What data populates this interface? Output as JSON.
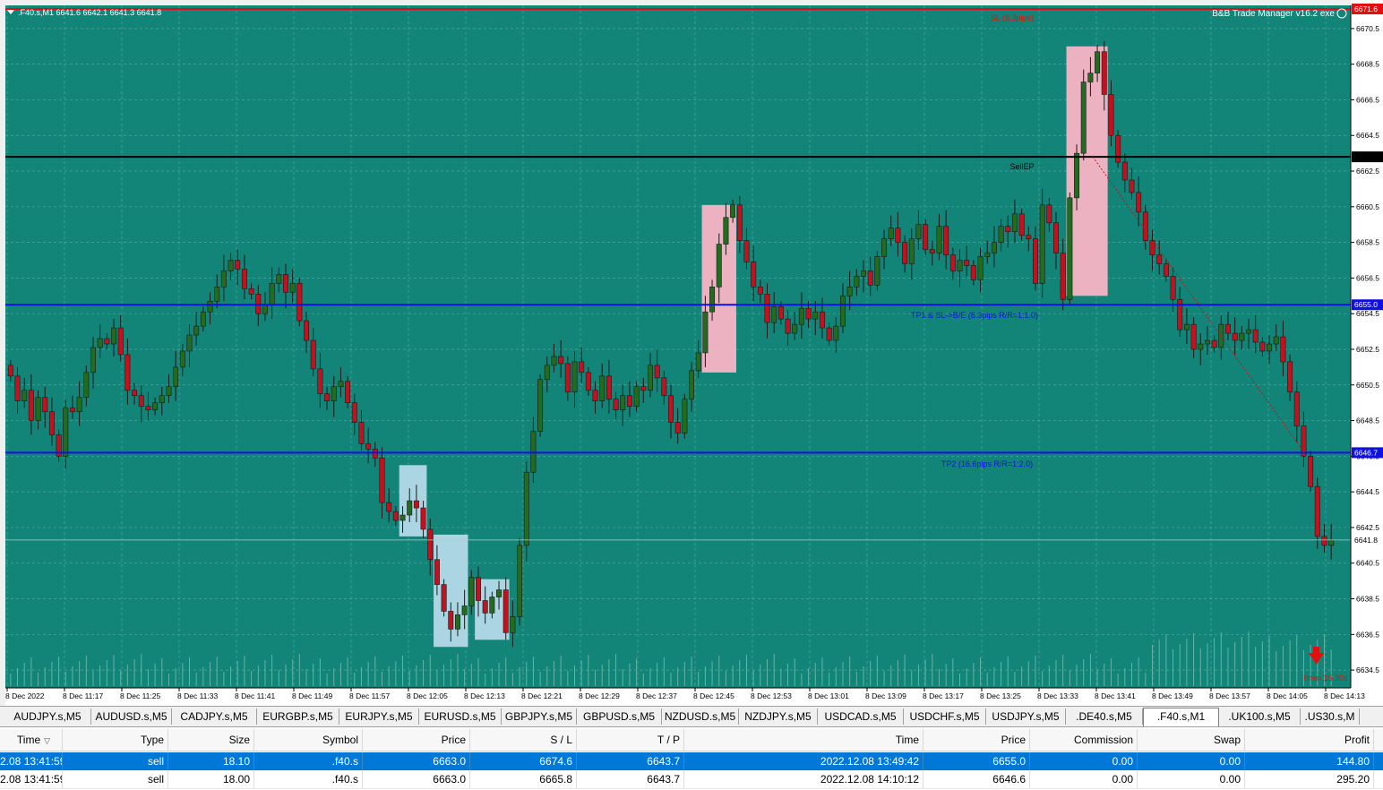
{
  "chart": {
    "header_text": ".F40.s,M1  6641.6 6642.1 6641.3 6641.8",
    "ea_label": "B&B Trade Manager v16.2 exe",
    "sl_label": "SL (8.3pips)",
    "sell_ep_label": "SellEP",
    "tp1_label": "TP1 & SL->B/E (8.3pips R/R=1:1.0)",
    "tp2_label": "TP2 (16.6pips R/R=1:2.0)",
    "countdown_label": "0min 15.20s",
    "price_tags": {
      "sl": "6671.6",
      "sell_ep": "6663.3",
      "tp1": "6655.0",
      "tp2": "6646.7",
      "bid": "6641.8"
    },
    "y_axis_ticks": [
      "6670.5",
      "6668.5",
      "6666.5",
      "6664.5",
      "6662.5",
      "6660.5",
      "6658.5",
      "6656.5",
      "6654.5",
      "6652.5",
      "6650.5",
      "6648.5",
      "6646.5",
      "6644.5",
      "6642.5",
      "6640.5",
      "6638.5",
      "6636.5",
      "6634.5"
    ],
    "x_axis_ticks": [
      "8 Dec 2022",
      "8 Dec 11:17",
      "8 Dec 11:25",
      "8 Dec 11:33",
      "8 Dec 11:41",
      "8 Dec 11:49",
      "8 Dec 11:57",
      "8 Dec 12:05",
      "8 Dec 12:13",
      "8 Dec 12:21",
      "8 Dec 12:29",
      "8 Dec 12:37",
      "8 Dec 12:45",
      "8 Dec 12:53",
      "8 Dec 13:01",
      "8 Dec 13:09",
      "8 Dec 13:17",
      "8 Dec 13:25",
      "8 Dec 13:33",
      "8 Dec 13:41",
      "8 Dec 13:49",
      "8 Dec 13:57",
      "8 Dec 14:05",
      "8 Dec 14:13"
    ],
    "colors": {
      "background": "#138478",
      "grid": "#4fa89d",
      "bull": "#236b1f",
      "bear": "#c1121f",
      "sl_line": "#e01010",
      "entry_line": "#000000",
      "tp_line": "#1010e0",
      "pink_zone": "#ffb6c8",
      "blue_zone": "#b8dcec"
    },
    "chart_data": {
      "type": "candlestick",
      "symbol": ".F40.s",
      "timeframe": "M1",
      "ylim": [
        6633.5,
        6671.8
      ],
      "levels": {
        "sl": 6671.6,
        "sell_entry": 6663.3,
        "tp1": 6655.0,
        "tp2": 6646.7,
        "bid": 6641.8
      },
      "close_prices": [
        6651.0,
        6649.6,
        6650.2,
        6648.5,
        6649.8,
        6649.0,
        6647.7,
        6646.5,
        6649.2,
        6649.0,
        6649.8,
        6651.2,
        6652.6,
        6653.1,
        6652.8,
        6653.7,
        6652.2,
        6650.2,
        6649.9,
        6649.3,
        6649.1,
        6649.5,
        6649.9,
        6650.4,
        6651.5,
        6652.4,
        6653.3,
        6653.8,
        6654.6,
        6655.2,
        6656.0,
        6656.9,
        6657.5,
        6657.0,
        6655.9,
        6655.6,
        6654.5,
        6655.0,
        6656.2,
        6656.7,
        6655.7,
        6656.2,
        6654.1,
        6653.0,
        6651.4,
        6650.0,
        6649.6,
        6650.4,
        6650.7,
        6649.5,
        6648.4,
        6647.2,
        6646.9,
        6646.4,
        6643.9,
        6643.4,
        6642.9,
        6643.2,
        6644.0,
        6643.6,
        6642.4,
        6640.7,
        6639.3,
        6637.8,
        6636.8,
        6637.6,
        6638.1,
        6639.7,
        6638.4,
        6637.7,
        6638.6,
        6639.0,
        6636.6,
        6637.5,
        6641.5,
        6645.6,
        6647.9,
        6650.8,
        6651.6,
        6652.1,
        6651.7,
        6650.1,
        6651.8,
        6651.2,
        6650.2,
        6649.6,
        6651.0,
        6649.7,
        6649.1,
        6649.9,
        6649.3,
        6650.4,
        6650.2,
        6651.6,
        6650.9,
        6649.9,
        6648.4,
        6647.8,
        6649.7,
        6651.3,
        6652.3,
        6654.6,
        6656.0,
        6658.4,
        6659.9,
        6660.6,
        6658.6,
        6657.4,
        6656.0,
        6655.6,
        6654.0,
        6654.9,
        6654.2,
        6653.4,
        6653.9,
        6654.8,
        6654.2,
        6654.6,
        6653.7,
        6653.0,
        6653.8,
        6655.5,
        6656.0,
        6656.6,
        6656.9,
        6656.1,
        6657.7,
        6658.7,
        6659.3,
        6658.5,
        6657.3,
        6658.7,
        6659.5,
        6658.1,
        6657.9,
        6659.4,
        6657.8,
        6656.9,
        6657.5,
        6657.2,
        6656.4,
        6657.7,
        6657.9,
        6658.5,
        6659.4,
        6659.1,
        6660.1,
        6658.9,
        6658.7,
        6656.2,
        6660.6,
        6659.6,
        6657.9,
        6655.3,
        6661.0,
        6663.5,
        6667.5,
        6668.0,
        6669.2,
        6666.8,
        6664.5,
        6663.0,
        6662.0,
        6661.3,
        6660.2,
        6658.6,
        6657.8,
        6657.3,
        6656.6,
        6655.3,
        6653.6,
        6653.9,
        6652.5,
        6652.8,
        6653.0,
        6652.6,
        6653.9,
        6653.4,
        6653.0,
        6653.4,
        6653.6,
        6652.9,
        6652.4,
        6652.8,
        6653.2,
        6651.8,
        6650.1,
        6648.2,
        6646.5,
        6644.8,
        6642.0,
        6641.5,
        6641.8
      ],
      "y_axis_tick_values": [
        6670.5,
        6668.5,
        6666.5,
        6664.5,
        6662.5,
        6660.5,
        6658.5,
        6656.5,
        6654.5,
        6652.5,
        6650.5,
        6648.5,
        6646.5,
        6644.5,
        6642.5,
        6640.5,
        6638.5,
        6636.5,
        6634.5
      ]
    }
  },
  "tabs": {
    "items": [
      "AUDJPY.s,M5",
      "AUDUSD.s,M5",
      "CADJPY.s,M5",
      "EURGBP.s,M5",
      "EURJPY.s,M5",
      "EURUSD.s,M5",
      "GBPJPY.s,M5",
      "GBPUSD.s,M5",
      "NZDUSD.s,M5",
      "NZDJPY.s,M5",
      "USDCAD.s,M5",
      "USDCHF.s,M5",
      "USDJPY.s,M5",
      ".DE40.s,M5",
      ".F40.s,M1",
      ".UK100.s,M5",
      ".US30.s,M"
    ],
    "active_index": 14
  },
  "orders": {
    "columns": [
      "Time",
      "Type",
      "Size",
      "Symbol",
      "Price",
      "S / L",
      "T / P",
      "Time",
      "Price",
      "Commission",
      "Swap",
      "Profit"
    ],
    "rows": [
      [
        "2.08 13:41:59",
        "sell",
        "18.10",
        ".f40.s",
        "6663.0",
        "6674.6",
        "6643.7",
        "2022.12.08 13:49:42",
        "6655.0",
        "0.00",
        "0.00",
        "144.80"
      ],
      [
        "2.08 13:41:59",
        "sell",
        "18.00",
        ".f40.s",
        "6663.0",
        "6665.8",
        "6643.7",
        "2022.12.08 14:10:12",
        "6646.6",
        "0.00",
        "0.00",
        "295.20"
      ]
    ],
    "selected_row": 0
  }
}
